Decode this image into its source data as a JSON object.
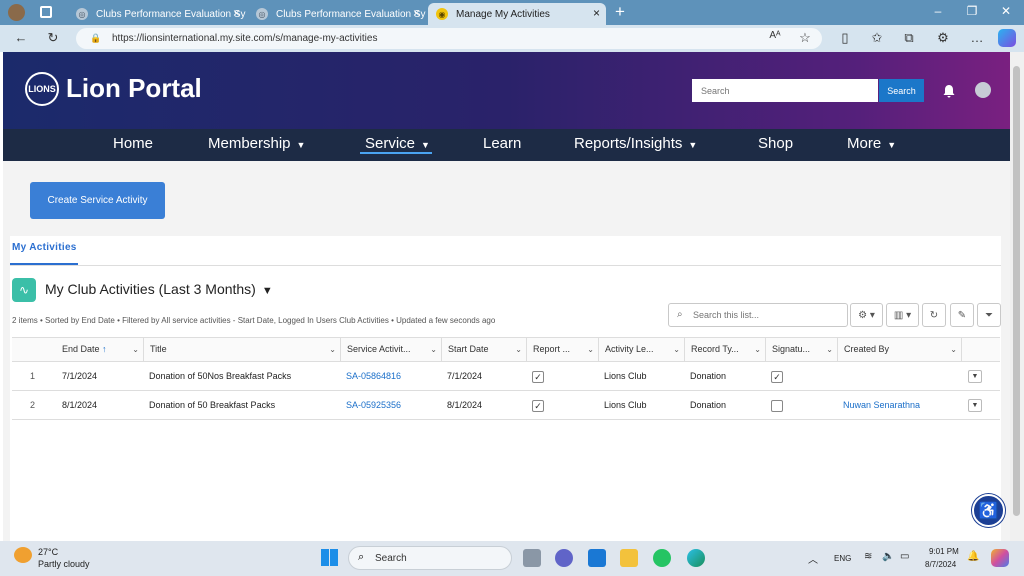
{
  "browser": {
    "tabs": [
      {
        "label": "Clubs Performance Evaluation Sy",
        "active": false
      },
      {
        "label": "Clubs Performance Evaluation Sy",
        "active": false
      },
      {
        "label": "Manage My Activities",
        "active": true
      }
    ],
    "url": "https://lionsinternational.my.site.com/s/manage-my-activities",
    "new_tab": "+"
  },
  "portal": {
    "logo_text": "LIONS",
    "title": "Lion Portal",
    "search_placeholder": "Search",
    "search_button": "Search"
  },
  "nav": {
    "items": [
      {
        "label": "Home",
        "has_menu": false
      },
      {
        "label": "Membership",
        "has_menu": true
      },
      {
        "label": "Service",
        "has_menu": true,
        "active": true
      },
      {
        "label": "Learn",
        "has_menu": false
      },
      {
        "label": "Reports/Insights",
        "has_menu": true
      },
      {
        "label": "Shop",
        "has_menu": false
      },
      {
        "label": "More",
        "has_menu": true
      }
    ]
  },
  "main": {
    "create_button": "Create Service Activity",
    "tab": "My Activities",
    "list_title": "My Club Activities (Last 3 Months)",
    "meta": "2 items • Sorted by End Date • Filtered by All service activities - Start Date, Logged In Users Club Activities • Updated a few seconds ago",
    "list_search_placeholder": "Search this list...",
    "columns": [
      "End Date",
      "Title",
      "Service Activit...",
      "Start Date",
      "Report ...",
      "Activity Le...",
      "Record Ty...",
      "Signatu...",
      "Created By"
    ],
    "sort_indicator": "↑",
    "rows": [
      {
        "num": "1",
        "end_date": "7/1/2024",
        "title": "Donation of 50Nos Breakfast Packs",
        "service_activity": "SA-05864816",
        "start_date": "7/1/2024",
        "report": true,
        "activity_level": "Lions Club",
        "record_type": "Donation",
        "signature": true,
        "created_by": ""
      },
      {
        "num": "2",
        "end_date": "8/1/2024",
        "title": "Donation of 50 Breakfast Packs",
        "service_activity": "SA-05925356",
        "start_date": "8/1/2024",
        "report": true,
        "activity_level": "Lions Club",
        "record_type": "Donation",
        "signature": false,
        "created_by": "Nuwan Senarathna"
      }
    ]
  },
  "taskbar": {
    "temp": "27°C",
    "weather": "Partly cloudy",
    "search": "Search",
    "lang": "ENG",
    "time": "9:01 PM",
    "date": "8/7/2024"
  }
}
